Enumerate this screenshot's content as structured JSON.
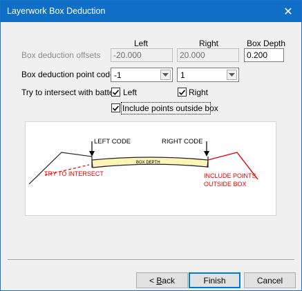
{
  "window": {
    "title": "Layerwork Box Deduction",
    "close_glyph": "✕"
  },
  "headers": {
    "left": "Left",
    "right": "Right",
    "box_depth": "Box Depth"
  },
  "offsets": {
    "label": "Box deduction offsets",
    "left_value": "-20.000",
    "right_value": "20.000",
    "box_depth_value": "0.200"
  },
  "point_codes": {
    "label": "Box deduction point codes",
    "left_value": "-1",
    "right_value": "1"
  },
  "batters": {
    "label": "Try to intersect with batters",
    "left_label": "Left",
    "left_checked": true,
    "right_label": "Right",
    "right_checked": true
  },
  "include_outside": {
    "label": "Include points outside box",
    "checked": true
  },
  "diagram": {
    "left_code": "LEFT CODE",
    "right_code": "RIGHT CODE",
    "box_depth": "BOX DEPTH",
    "try_intersect": "TRY TO INTERSECT",
    "include_points_line1": "INCLUDE POINTS",
    "include_points_line2": "OUTSIDE BOX"
  },
  "buttons": {
    "back_underline": "B",
    "back_rest": "ack",
    "back_prefix": "< ",
    "finish": "Finish",
    "cancel": "Cancel"
  },
  "colors": {
    "title_bar": "#0f6fc6",
    "red": "#e00000",
    "box_fill": "#fdf4b8",
    "button_focus": "#0078d7"
  }
}
